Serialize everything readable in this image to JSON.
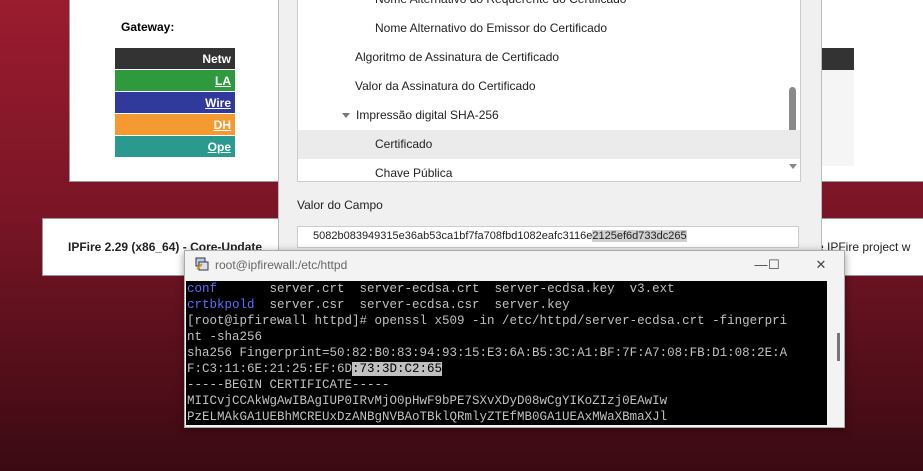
{
  "bg_page": {
    "gateway_label": "Gateway:",
    "network_header": "Netw",
    "network_rows": [
      {
        "label": "LA",
        "color": "#2e9a3d"
      },
      {
        "label": "Wire",
        "color": "#2f3a9c"
      },
      {
        "label": "DH",
        "color": "#f59a30"
      },
      {
        "label": "Ope",
        "color": "#2a9a8e"
      }
    ],
    "footer_text": "IPFire 2.29 (x86_64) - Core-Update",
    "footer_right": "e IPFire project w"
  },
  "cert_dialog": {
    "tree_items": [
      {
        "label": "Nome Alternativo do Requerente do Certificado",
        "indent": 2,
        "arrow": false,
        "selected": false
      },
      {
        "label": "Nome Alternativo do Emissor do Certificado",
        "indent": 2,
        "arrow": false,
        "selected": false
      },
      {
        "label": "Algoritmo de Assinatura de Certificado",
        "indent": 1,
        "arrow": false,
        "selected": false
      },
      {
        "label": "Valor da Assinatura do Certificado",
        "indent": 1,
        "arrow": false,
        "selected": false
      },
      {
        "label": "Impressão digital SHA-256",
        "indent": 1,
        "arrow": true,
        "selected": false
      },
      {
        "label": "Certificado",
        "indent": 2,
        "arrow": false,
        "selected": true
      },
      {
        "label": "Chave Pública",
        "indent": 2,
        "arrow": false,
        "selected": false
      }
    ],
    "field_label": "Valor do Campo",
    "field_value_plain": "5082b083949315e36ab53ca1bf7fa708fbd1082eafc3116e",
    "field_value_highlight": "2125ef6d733dc265"
  },
  "terminal": {
    "title": "root@ipfirewall:/etc/httpd",
    "buttons": {
      "minimize": "—",
      "maximize": "☐",
      "close": "✕"
    },
    "lines": [
      {
        "blue": "conf",
        "rest": "       server.crt  server-ecdsa.crt  server-ecdsa.key  v3.ext"
      },
      {
        "blue": "crtbkpold",
        "rest": "  server.csr  server-ecdsa.csr  server.key"
      },
      {
        "blue": "",
        "rest": "[root@ipfirewall httpd]# openssl x509 -in /etc/httpd/server-ecdsa.crt -fingerpri"
      },
      {
        "blue": "",
        "rest": "nt -sha256"
      },
      {
        "blue": "",
        "rest": "sha256 Fingerprint=50:82:B0:83:94:93:15:E3:6A:B5:3C:A1:BF:7F:A7:08:FB:D1:08:2E:A"
      },
      {
        "blue": "",
        "rest": "F:C3:11:6E:21:25:EF:6D",
        "hl": ":73:3D:C2:65"
      },
      {
        "blue": "",
        "rest": "-----BEGIN CERTIFICATE-----"
      },
      {
        "blue": "",
        "rest": "MIICvjCCAkWgAwIBAgIUP0IRvMjO0pHwF9bPE7SXvXDyD08wCgYIKoZIzj0EAwIw"
      },
      {
        "blue": "",
        "rest": "PzELMAkGA1UEBhMCREUxDzANBgNVBAoTBklQRmlyZTEfMB0GA1UEAxMWaXBmaXJl"
      }
    ]
  }
}
